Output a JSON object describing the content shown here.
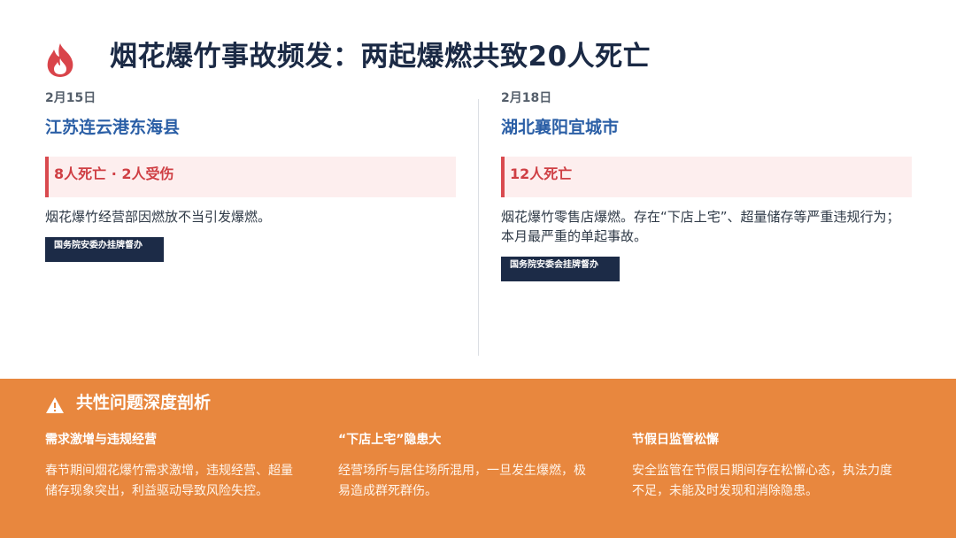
{
  "header": {
    "title": "烟花爆竹事故频发：两起爆燃共致20人死亡",
    "icon": "flame-icon"
  },
  "cases": [
    {
      "date": "2月15日",
      "place": "江苏连云港东海县",
      "casualty": "8人死亡 · 2人受伤",
      "description": "烟花爆竹经营部因燃放不当引发爆燃。",
      "tag": "国务院安委办挂牌督办"
    },
    {
      "date": "2月18日",
      "place": "湖北襄阳宜城市",
      "casualty": "12人死亡",
      "description": "烟花爆竹零售店爆燃。存在“下店上宅”、超量储存等严重违规行为；本月最严重的单起事故。",
      "tag": "国务院安委会挂牌督办"
    }
  ],
  "analysis": {
    "heading": "共性问题深度剖析",
    "icon": "warning-icon",
    "columns": [
      {
        "title": "需求激增与违规经营",
        "text": "春节期间烟花爆竹需求激增，违规经营、超量储存现象突出，利益驱动导致风险失控。"
      },
      {
        "title": "“下店上宅”隐患大",
        "text": "经营场所与居住场所混用，一旦发生爆燃，极易造成群死群伤。"
      },
      {
        "title": "节假日监管松懈",
        "text": "安全监管在节假日期间存在松懈心态，执法力度不足，未能及时发现和消除隐患。"
      }
    ]
  },
  "colors": {
    "title": "#1b2a45",
    "place": "#2b5fa6",
    "casualty_text": "#cf3f44",
    "casualty_bg": "#fdeeee",
    "tag_bg": "#1c2b47",
    "analysis_bg": "#e8873e"
  }
}
